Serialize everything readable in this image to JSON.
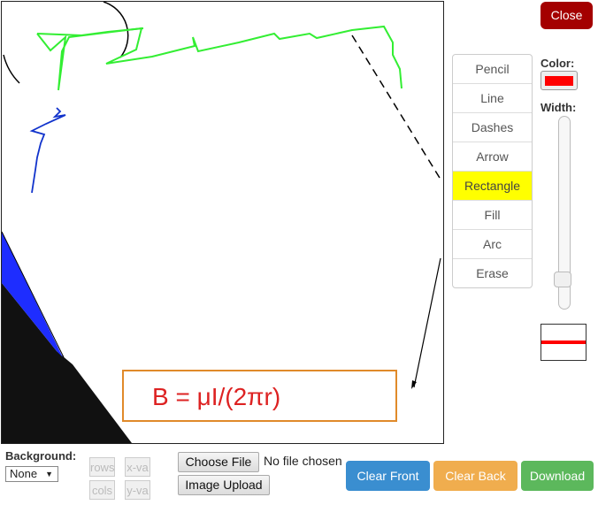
{
  "window": {
    "close_label": "Close"
  },
  "canvas": {
    "formula_text": "B = μI/(2πr)",
    "stroke_colors": {
      "green": "#33ee33",
      "blue": "#1133cc",
      "black": "#000000",
      "fill_blue": "#1e2dff",
      "formula": "#dd2222",
      "box": "#e08a2a"
    }
  },
  "tools": {
    "items": [
      {
        "label": "Pencil",
        "active": false
      },
      {
        "label": "Line",
        "active": false
      },
      {
        "label": "Dashes",
        "active": false
      },
      {
        "label": "Arrow",
        "active": false
      },
      {
        "label": "Rectangle",
        "active": true
      },
      {
        "label": "Fill",
        "active": false
      },
      {
        "label": "Arc",
        "active": false
      },
      {
        "label": "Erase",
        "active": false
      }
    ],
    "active_color": "#ffff00"
  },
  "options": {
    "color_label": "Color:",
    "color_value": "#ff0000",
    "width_label": "Width:"
  },
  "bottom": {
    "background_label": "Background:",
    "background_value": "None",
    "rows_label": "rows",
    "cols_label": "cols",
    "xva_label": "x-va",
    "yva_label": "y-va",
    "choose_file_label": "Choose File",
    "file_status": "No file chosen",
    "image_upload_label": "Image Upload",
    "clear_front_label": "Clear Front",
    "clear_back_label": "Clear Back",
    "download_label": "Download",
    "colors": {
      "clear_front": "#3a8ed0",
      "clear_back": "#f0ad4e",
      "download": "#5cb85c"
    }
  }
}
